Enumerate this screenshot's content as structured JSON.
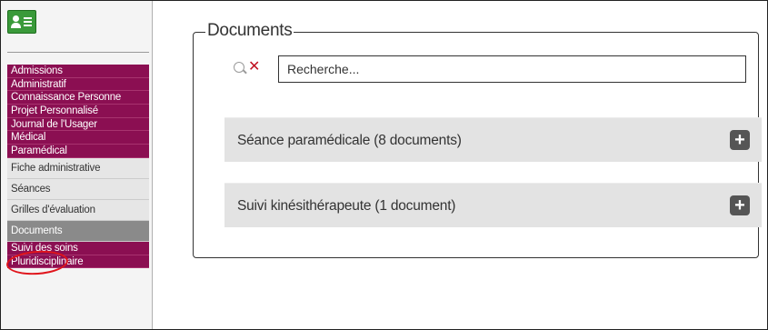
{
  "sidebar": {
    "app_icon": "contact-card-icon",
    "categories_top": [
      "Admissions",
      "Administratif",
      "Connaissance Personne",
      "Projet Personnalisé",
      "Journal de l'Usager",
      "Médical",
      "Paramédical"
    ],
    "sub_items": [
      "Fiche administrative",
      "Séances",
      "Grilles d'évaluation",
      "Documents"
    ],
    "active_sub_item": "Documents",
    "categories_bottom": [
      "Suivi des soins",
      "Pluridisciplinaire"
    ]
  },
  "main": {
    "section_title": "Documents",
    "search": {
      "placeholder": "Recherche...",
      "value": "",
      "icon": "search-icon",
      "clear_icon": "clear-icon"
    },
    "groups": [
      {
        "label": "Séance paramédicale (8 documents)",
        "icon": "plus-icon"
      },
      {
        "label": "Suivi kinésithérapeute (1 document)",
        "icon": "plus-icon"
      }
    ]
  },
  "colors": {
    "category_bg": "#8b0f52",
    "active_bg": "#8a8a8a",
    "annotation_ring": "#e0141b",
    "group_bg": "#e3e3e3"
  }
}
